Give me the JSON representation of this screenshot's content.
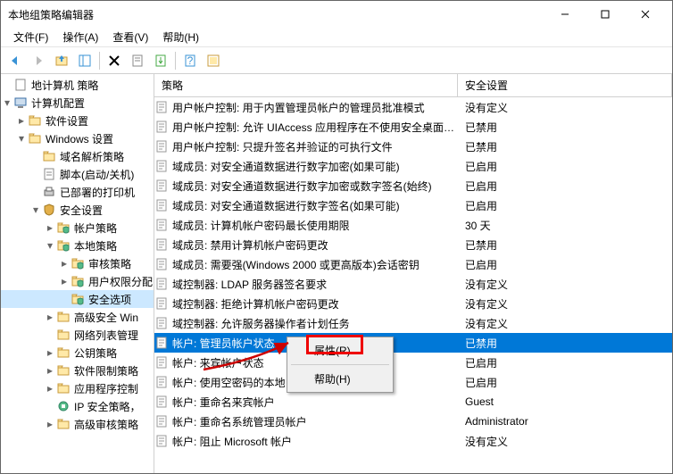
{
  "window": {
    "title": "本地组策略编辑器"
  },
  "menus": {
    "file": "文件(F)",
    "action": "操作(A)",
    "view": "查看(V)",
    "help": "帮助(H)"
  },
  "columns": {
    "policy": "策略",
    "setting": "安全设置"
  },
  "tree": [
    {
      "label": "地计算机 策略",
      "depth": 0,
      "icon": "root",
      "expand": ""
    },
    {
      "label": "计算机配置",
      "depth": 0,
      "icon": "computer",
      "expand": "▾"
    },
    {
      "label": "软件设置",
      "depth": 1,
      "icon": "folder",
      "expand": "▸"
    },
    {
      "label": "Windows 设置",
      "depth": 1,
      "icon": "folder",
      "expand": "▾"
    },
    {
      "label": "域名解析策略",
      "depth": 2,
      "icon": "folder",
      "expand": ""
    },
    {
      "label": "脚本(启动/关机)",
      "depth": 2,
      "icon": "script",
      "expand": ""
    },
    {
      "label": "已部署的打印机",
      "depth": 2,
      "icon": "printer",
      "expand": ""
    },
    {
      "label": "安全设置",
      "depth": 2,
      "icon": "shield",
      "expand": "▾"
    },
    {
      "label": "帐户策略",
      "depth": 3,
      "icon": "folder-shield",
      "expand": "▸"
    },
    {
      "label": "本地策略",
      "depth": 3,
      "icon": "folder-shield",
      "expand": "▾"
    },
    {
      "label": "审核策略",
      "depth": 4,
      "icon": "folder-shield",
      "expand": "▸"
    },
    {
      "label": "用户权限分配",
      "depth": 4,
      "icon": "folder-shield",
      "expand": "▸"
    },
    {
      "label": "安全选项",
      "depth": 4,
      "icon": "folder-shield",
      "expand": "",
      "selected": true
    },
    {
      "label": "高级安全 Win",
      "depth": 3,
      "icon": "folder",
      "expand": "▸"
    },
    {
      "label": "网络列表管理",
      "depth": 3,
      "icon": "folder",
      "expand": ""
    },
    {
      "label": "公钥策略",
      "depth": 3,
      "icon": "folder",
      "expand": "▸"
    },
    {
      "label": "软件限制策略",
      "depth": 3,
      "icon": "folder",
      "expand": "▸"
    },
    {
      "label": "应用程序控制",
      "depth": 3,
      "icon": "folder",
      "expand": "▸"
    },
    {
      "label": "IP 安全策略，",
      "depth": 3,
      "icon": "ipsec",
      "expand": ""
    },
    {
      "label": "高级审核策略",
      "depth": 3,
      "icon": "folder",
      "expand": "▸"
    }
  ],
  "rows": [
    {
      "policy": "用户帐户控制: 用于内置管理员帐户的管理员批准模式",
      "setting": "没有定义"
    },
    {
      "policy": "用户帐户控制: 允许 UIAccess 应用程序在不使用安全桌面…",
      "setting": "已禁用"
    },
    {
      "policy": "用户帐户控制: 只提升签名并验证的可执行文件",
      "setting": "已禁用"
    },
    {
      "policy": "域成员: 对安全通道数据进行数字加密(如果可能)",
      "setting": "已启用"
    },
    {
      "policy": "域成员: 对安全通道数据进行数字加密或数字签名(始终)",
      "setting": "已启用"
    },
    {
      "policy": "域成员: 对安全通道数据进行数字签名(如果可能)",
      "setting": "已启用"
    },
    {
      "policy": "域成员: 计算机帐户密码最长使用期限",
      "setting": "30 天"
    },
    {
      "policy": "域成员: 禁用计算机帐户密码更改",
      "setting": "已禁用"
    },
    {
      "policy": "域成员: 需要强(Windows 2000 或更高版本)会话密钥",
      "setting": "已启用"
    },
    {
      "policy": "域控制器: LDAP 服务器签名要求",
      "setting": "没有定义"
    },
    {
      "policy": "域控制器: 拒绝计算机帐户密码更改",
      "setting": "没有定义"
    },
    {
      "policy": "域控制器: 允许服务器操作者计划任务",
      "setting": "没有定义"
    },
    {
      "policy": "帐户: 管理员帐户状态",
      "setting": "已禁用",
      "selected": true
    },
    {
      "policy": "帐户: 来宾帐户状态",
      "setting": "已启用"
    },
    {
      "policy": "帐户: 使用空密码的本地…",
      "setting": "已启用"
    },
    {
      "policy": "帐户: 重命名来宾帐户",
      "setting": "Guest"
    },
    {
      "policy": "帐户: 重命名系统管理员帐户",
      "setting": "Administrator"
    },
    {
      "policy": "帐户: 阻止 Microsoft 帐户",
      "setting": "没有定义"
    }
  ],
  "context_menu": {
    "properties": "属性(R)",
    "help": "帮助(H)"
  }
}
